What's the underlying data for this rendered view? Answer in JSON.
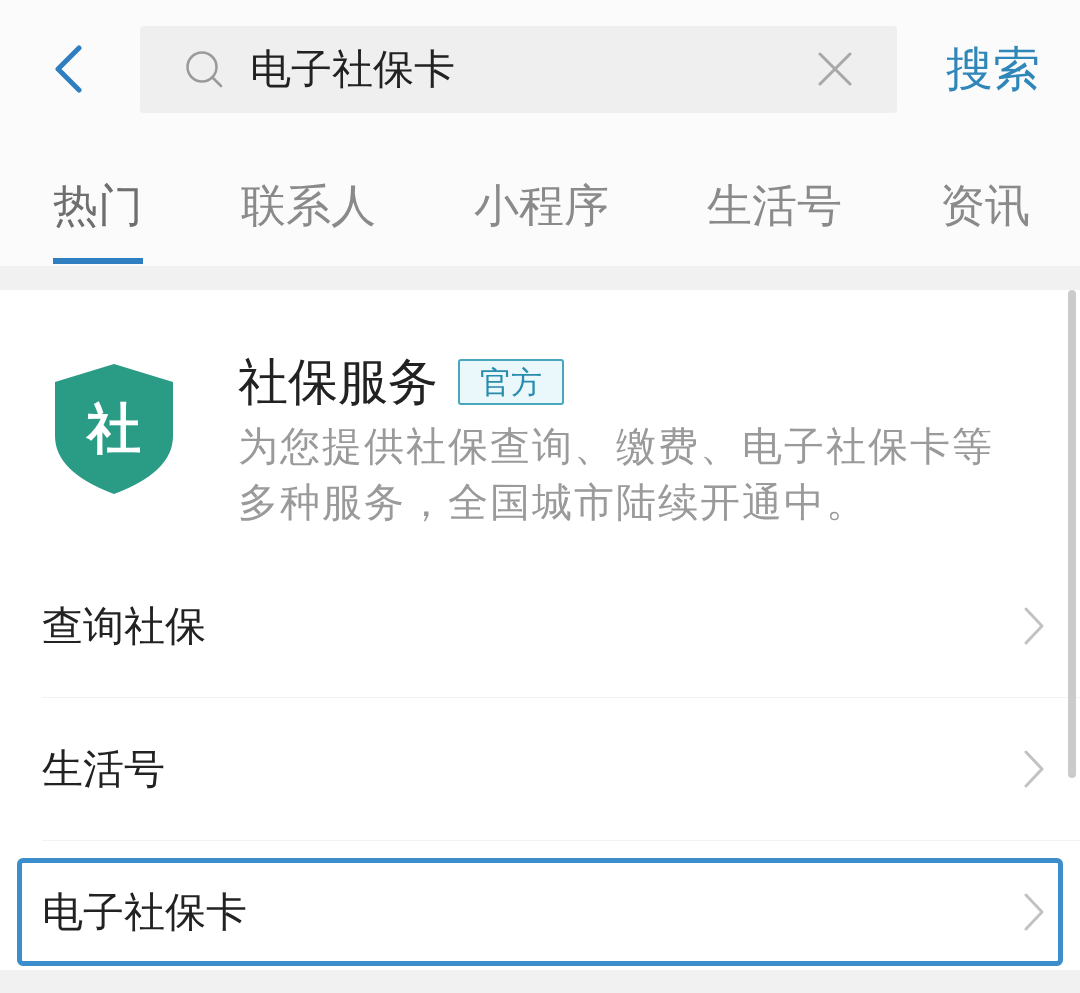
{
  "search_bar": {
    "value": "电子社保卡",
    "button": "搜索"
  },
  "tabs": [
    {
      "label": "热门",
      "selected": true
    },
    {
      "label": "联系人",
      "selected": false
    },
    {
      "label": "小程序",
      "selected": false
    },
    {
      "label": "生活号",
      "selected": false
    },
    {
      "label": "资讯",
      "selected": false
    }
  ],
  "service": {
    "logo_char": "社",
    "title": "社保服务",
    "badge": "官方",
    "description": "为您提供社保查询、缴费、电子社保卡等多种服务，全国城市陆续开通中。"
  },
  "results": [
    {
      "label": "查询社保",
      "highlighted": false
    },
    {
      "label": "生活号",
      "highlighted": false
    },
    {
      "label": "电子社保卡",
      "highlighted": true
    }
  ]
}
